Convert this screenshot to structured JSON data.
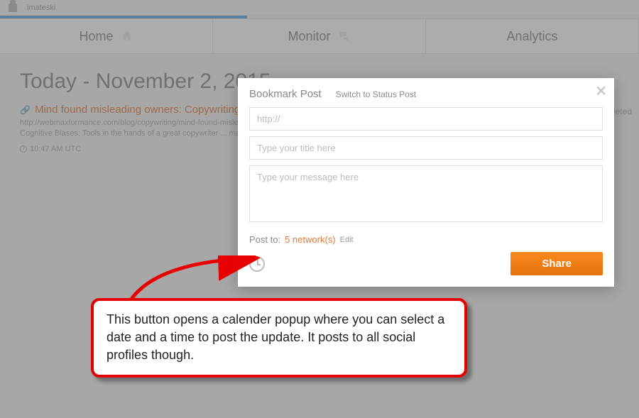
{
  "userbar": {
    "username": "imateski"
  },
  "tabs": {
    "home": "Home",
    "monitor": "Monitor",
    "analytics": "Analytics"
  },
  "content": {
    "date_heading": "Today - November 2, 2015",
    "completed_text": "ompleted",
    "post": {
      "title": "Mind found misleading owners: Copywriting",
      "url": "http://webmaxformance.com/blog/copywriting/mind-found-misleading",
      "desc": "Cognitive Biases: Tools in the hands of a great copywriter ... make more sales of whatever you re selling, you searched online in",
      "time": "10:47 AM UTC"
    }
  },
  "modal": {
    "title": "Bookmark Post",
    "switch_label": "Switch to Status Post",
    "url_placeholder": "http://",
    "title_placeholder": "Type your title here",
    "message_placeholder": "Type your message here",
    "postto_label": "Post to:",
    "networks_text": "5 network(s)",
    "edit_label": "Edit",
    "share_label": "Share",
    "close_glyph": "✕"
  },
  "annotation": {
    "text": "This button opens a calender popup where you can select a date and a time to post the update. It posts to all social profiles though."
  }
}
